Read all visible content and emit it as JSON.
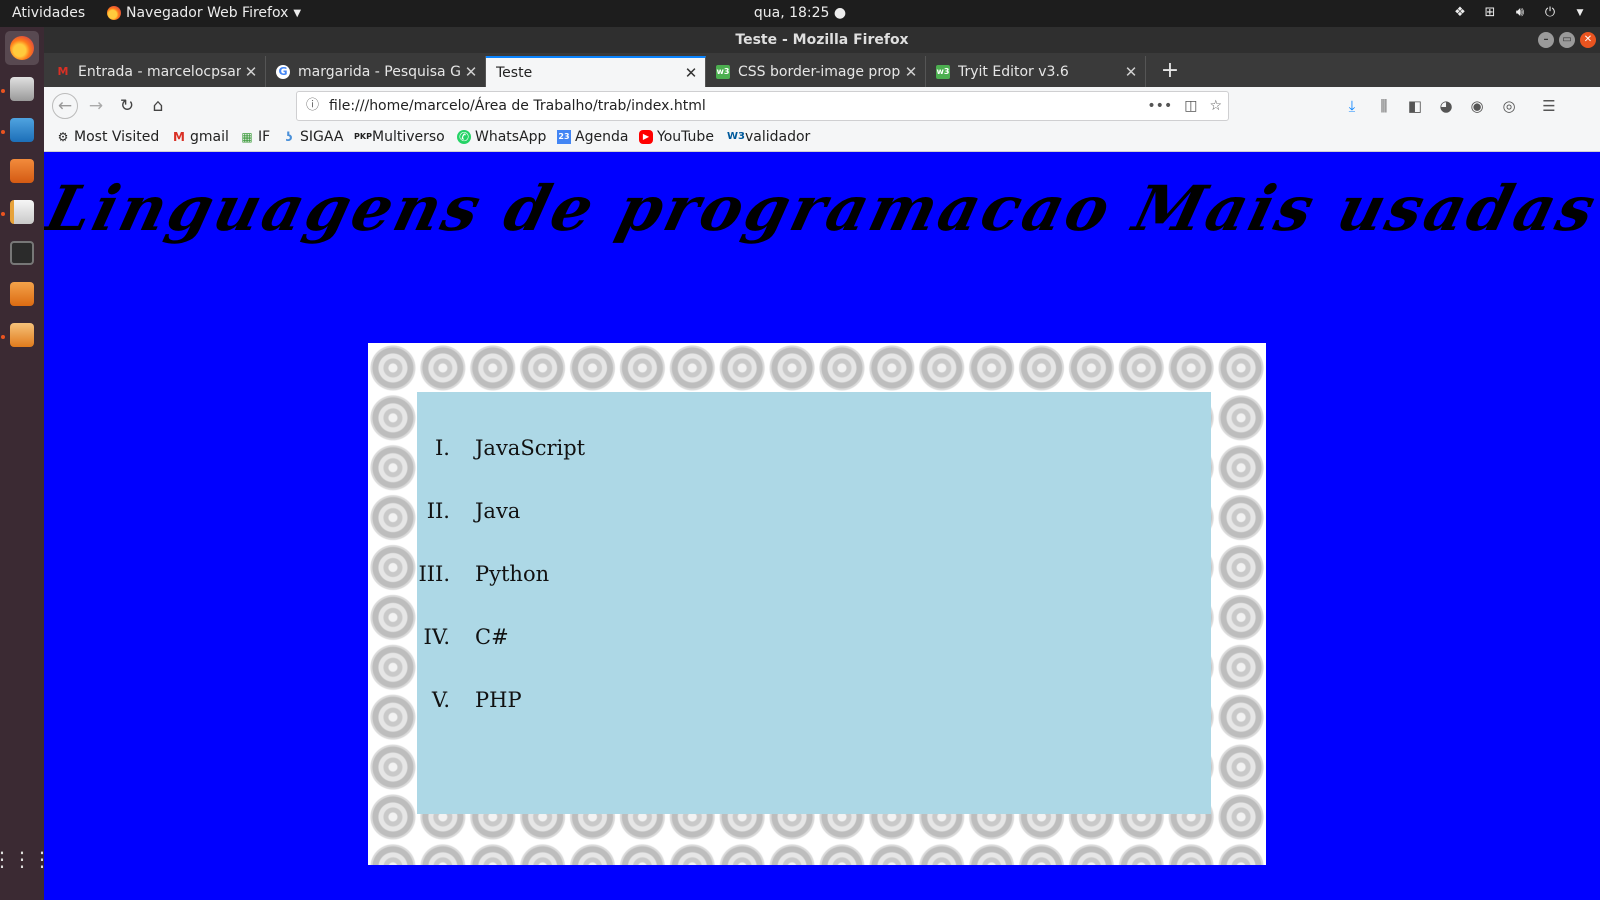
{
  "topbar": {
    "activities": "Atividades",
    "app_menu": "Navegador Web Firefox",
    "clock": "qua, 18:25"
  },
  "window": {
    "title": "Teste - Mozilla Firefox"
  },
  "tabs": [
    {
      "title": "Entrada - marcelocpsant",
      "favicon": "gmail-icon",
      "active": false
    },
    {
      "title": "margarida - Pesquisa Go",
      "favicon": "google-icon",
      "active": false
    },
    {
      "title": "Teste",
      "favicon": "",
      "active": true
    },
    {
      "title": "CSS border-image prope",
      "favicon": "w3schools-icon",
      "active": false
    },
    {
      "title": "Tryit Editor v3.6",
      "favicon": "w3schools-icon",
      "active": false
    }
  ],
  "urlbar": {
    "url": "file:///home/marcelo/Área de Trabalho/trab/index.html"
  },
  "bookmarks": [
    {
      "label": "Most Visited",
      "icon": "gear-icon"
    },
    {
      "label": "gmail",
      "icon": "gmail-icon"
    },
    {
      "label": "IF",
      "icon": "if-icon"
    },
    {
      "label": "SIGAA",
      "icon": "sigaa-icon"
    },
    {
      "label": "Multiverso",
      "icon": "pkp-icon"
    },
    {
      "label": "WhatsApp",
      "icon": "whatsapp-icon"
    },
    {
      "label": "Agenda",
      "icon": "calendar-icon"
    },
    {
      "label": "YouTube",
      "icon": "youtube-icon"
    },
    {
      "label": "validador",
      "icon": "w3c-icon"
    }
  ],
  "page": {
    "heading": "Linguagens de programacao Mais usadas",
    "background": "#0000ff",
    "box_background": "#add8e6",
    "list": [
      {
        "numeral": "I.",
        "label": "JavaScript"
      },
      {
        "numeral": "II.",
        "label": "Java"
      },
      {
        "numeral": "III.",
        "label": "Python"
      },
      {
        "numeral": "IV.",
        "label": "C#"
      },
      {
        "numeral": "V.",
        "label": "PHP"
      }
    ]
  }
}
